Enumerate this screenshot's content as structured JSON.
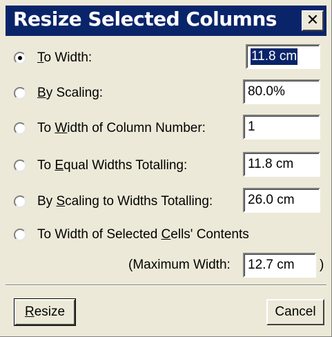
{
  "dialog": {
    "title": "Resize Selected Columns",
    "close_glyph": "✕"
  },
  "options": [
    {
      "pre": "",
      "u": "T",
      "post": "o Width:",
      "checked": true,
      "value": "11.8 cm"
    },
    {
      "pre": "",
      "u": "B",
      "post": "y Scaling:",
      "checked": false,
      "value": "80.0%"
    },
    {
      "pre": "To ",
      "u": "W",
      "post": "idth of Column Number:",
      "checked": false,
      "value": "1"
    },
    {
      "pre": "To ",
      "u": "E",
      "post": "qual Widths Totalling:",
      "checked": false,
      "value": "11.8 cm"
    },
    {
      "pre": "By ",
      "u": "S",
      "post": "caling to Widths Totalling:",
      "checked": false,
      "value": "26.0 cm"
    },
    {
      "pre": "To Width of Selected ",
      "u": "C",
      "post": "ells' Contents",
      "checked": false
    }
  ],
  "max_width": {
    "label": "(Maximum Width:",
    "value": "12.7 cm",
    "close_paren": ")"
  },
  "buttons": {
    "resize_u": "R",
    "resize_rest": "esize",
    "cancel": "Cancel"
  }
}
